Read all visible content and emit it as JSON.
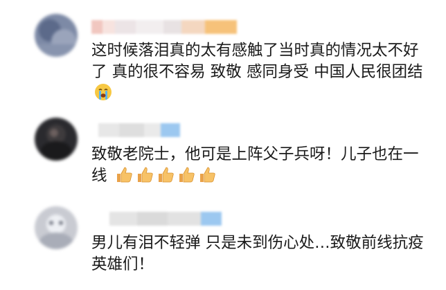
{
  "comments": [
    {
      "author": "",
      "text": "这时候落泪真的太有感触了当时真的情况太不好了 真的很不容易 致敬 感同身受 中国人民很团结",
      "emoji": "crying-face-icon"
    },
    {
      "author": "",
      "text": "致敬老院士，他可是上阵父子兵呀！儿子也在一线",
      "emoji": "thumbs-up-icon",
      "emoji_count": 5
    },
    {
      "author": "",
      "text": "男儿有泪不轻弹 只是未到伤心处…致敬前线抗疫英雄们！"
    }
  ],
  "colors": {
    "text": "#1a1a1a",
    "blurred_name": "#b6b6b6",
    "badge_blue": "#9cc8f0",
    "badge_orange": "#f6c27a"
  }
}
